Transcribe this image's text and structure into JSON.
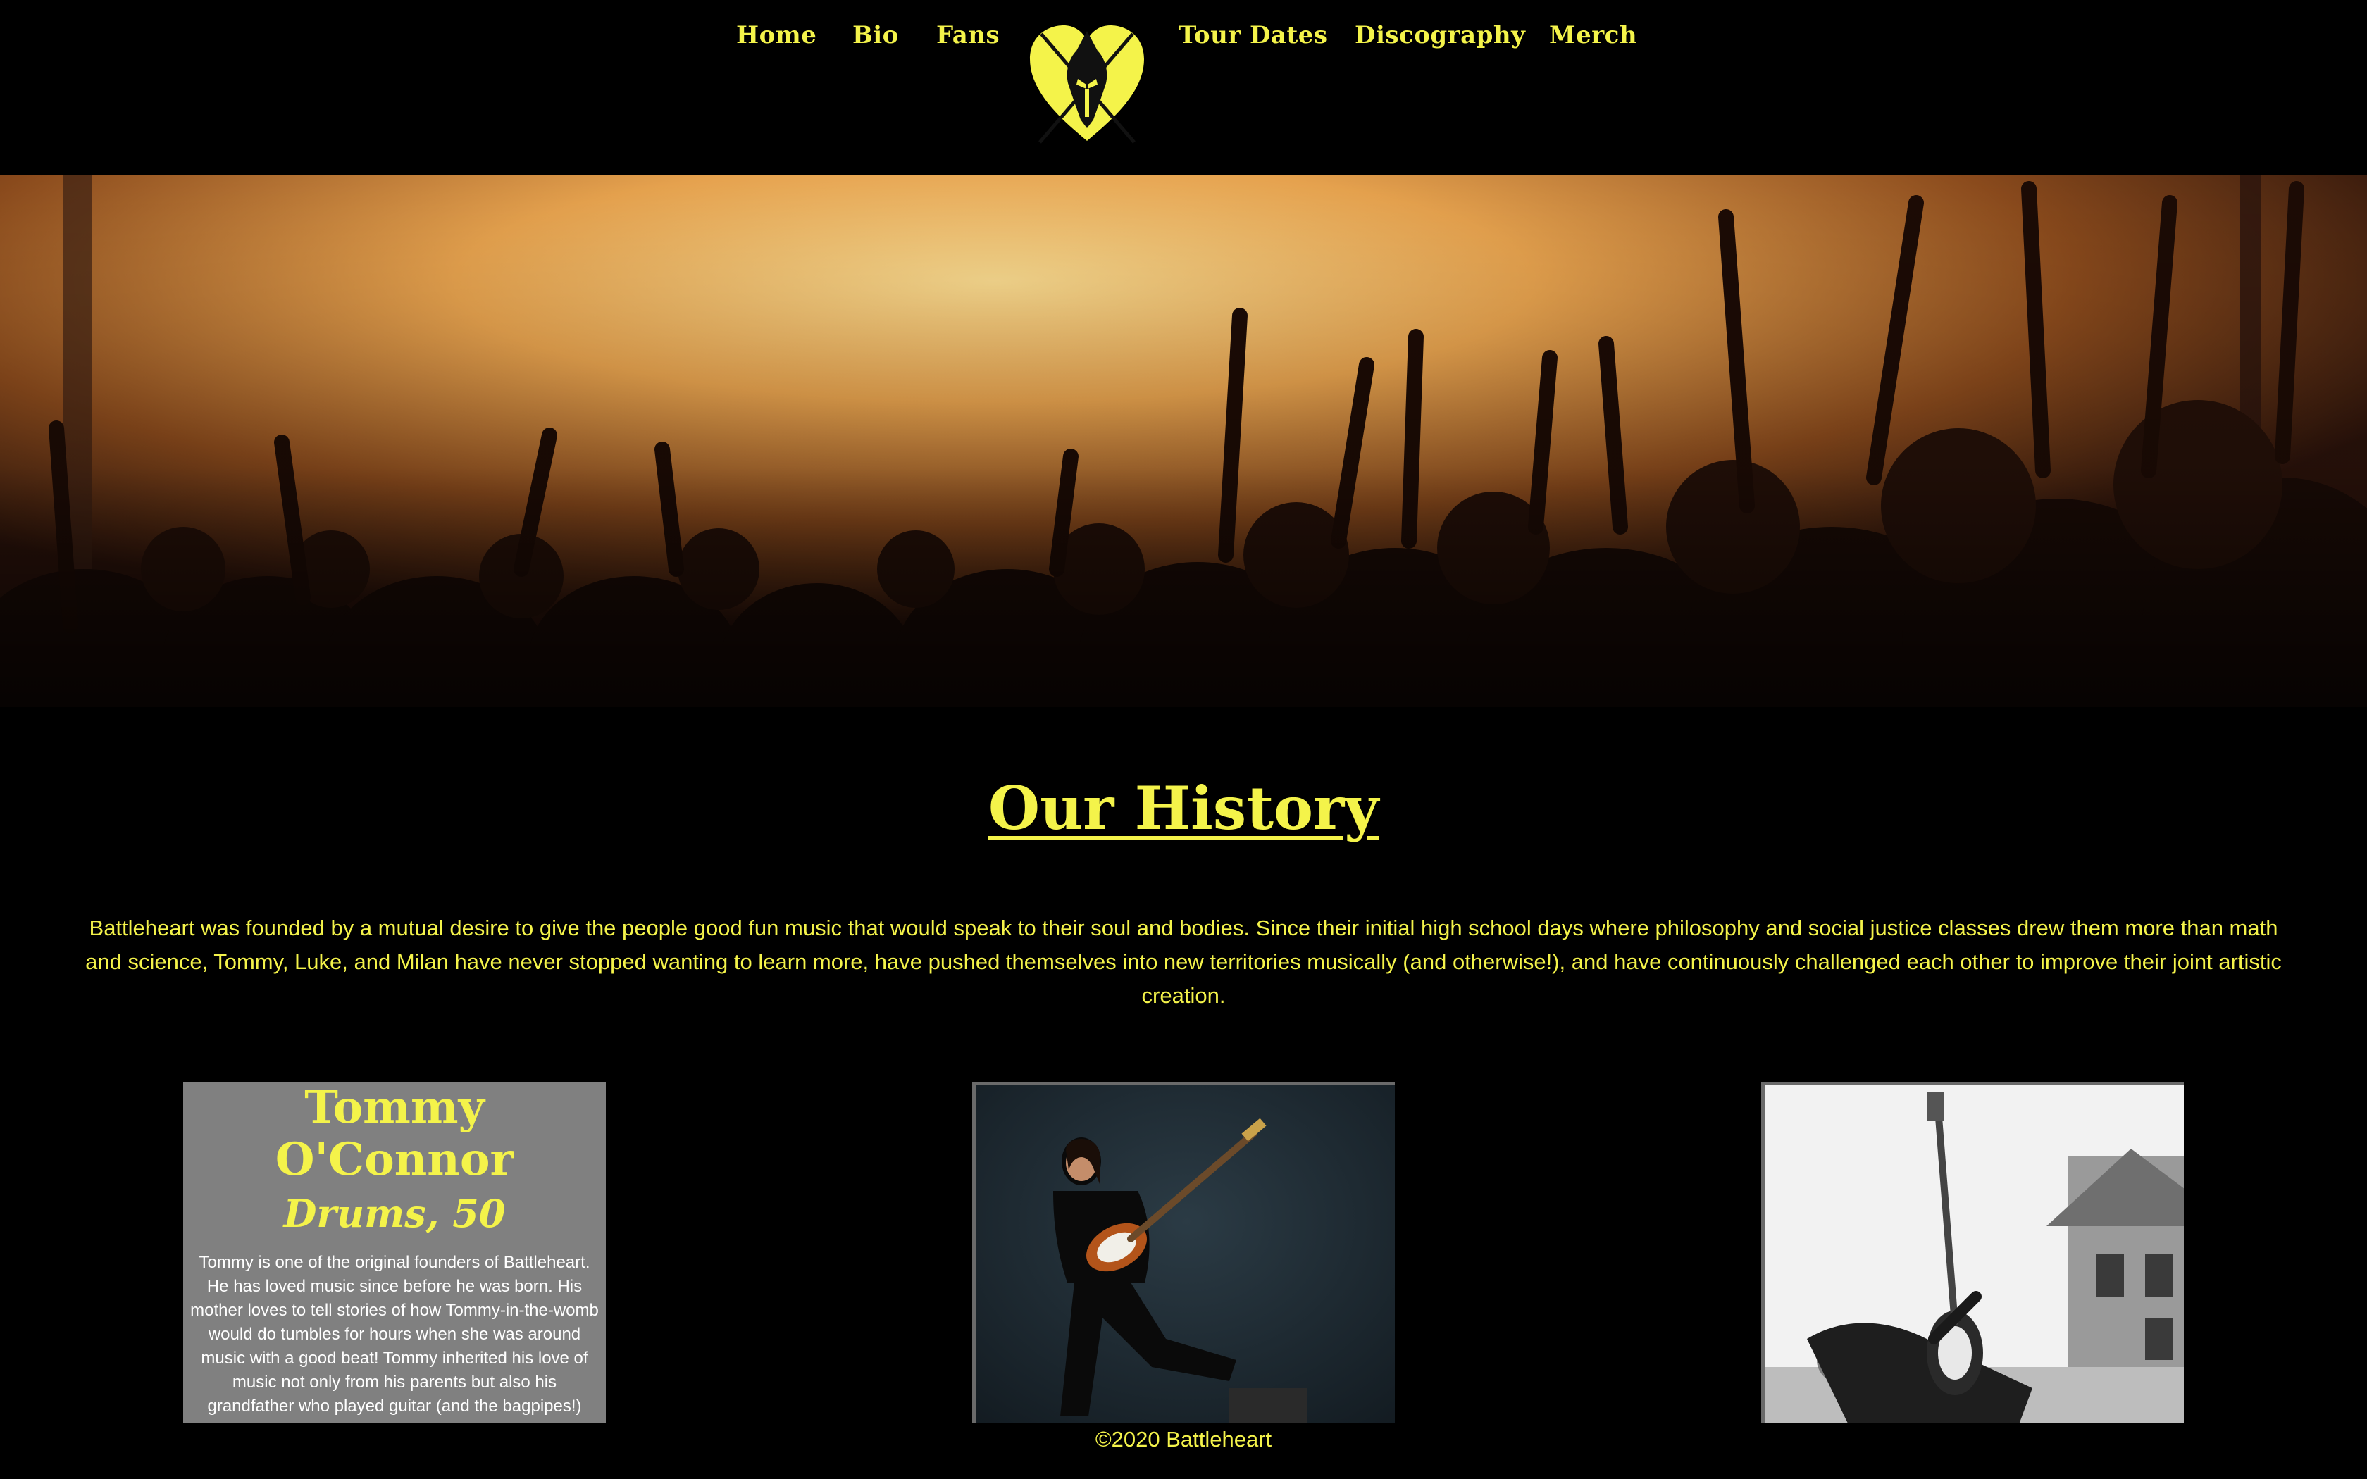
{
  "nav": {
    "links": [
      {
        "label": "Home"
      },
      {
        "label": "Bio"
      },
      {
        "label": "Fans"
      },
      {
        "label": "Tour Dates"
      },
      {
        "label": "Discography"
      },
      {
        "label": "Merch"
      }
    ],
    "logo_icon": "heart-helmet-logo-icon"
  },
  "colors": {
    "accent": "#f4f34a",
    "background": "#000000",
    "card_gray": "#808080"
  },
  "history": {
    "title": "Our History",
    "text": "Battleheart was founded by a mutual desire to give the people good fun music that would speak to their soul and bodies. Since their initial high school days where philosophy and social justice classes drew them more than math and science, Tommy, Luke, and Milan have never stopped wanting to learn more, have pushed themselves into new territories musically (and otherwise!), and have continuously challenged each other to improve their joint artistic creation."
  },
  "members": [
    {
      "name": "Tommy O'Connor",
      "role": "Drums, 50",
      "bio": "Tommy is one of the original founders of Battleheart. He has loved music since before he was born. His mother loves to tell stories of how Tommy-in-the-womb would do tumbles for hours when she was around music with a good beat! Tommy inherited his love of music not only from his parents but also his grandfather who played guitar (and the bagpipes!)"
    }
  ],
  "footer": {
    "text": "©2020 Battleheart"
  }
}
